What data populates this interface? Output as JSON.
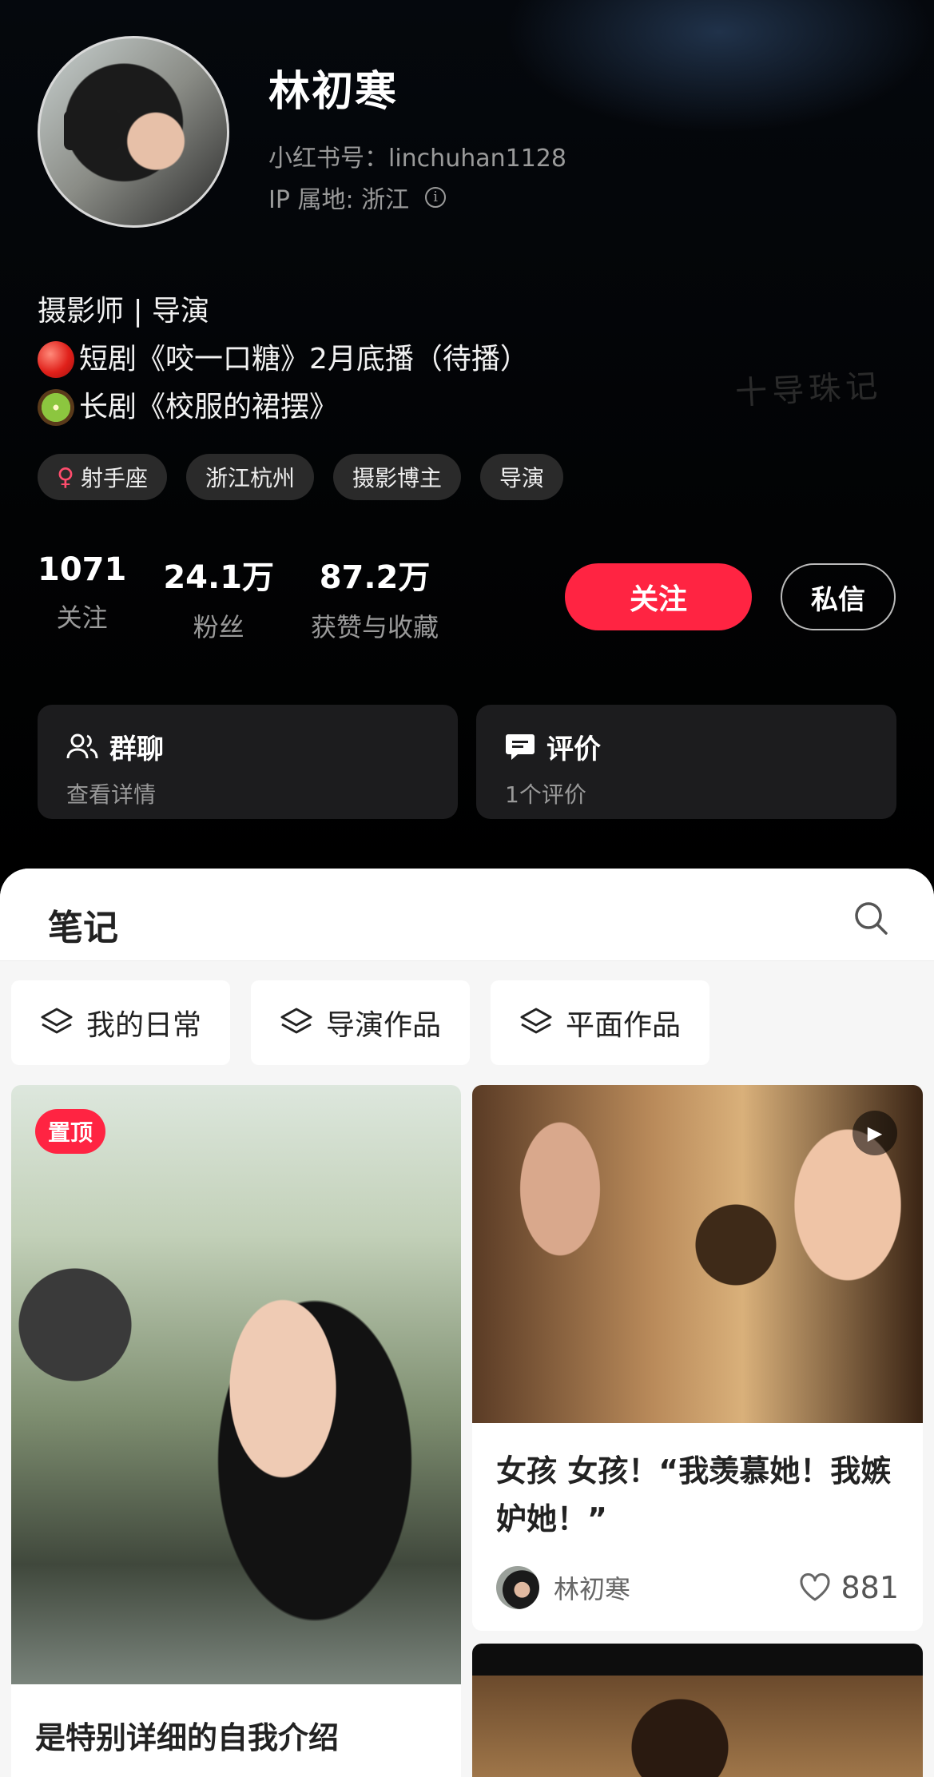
{
  "profile": {
    "name": "林初寒",
    "id_line": "小红书号：linchuhan1128",
    "ip_line": "IP 属地: 浙江",
    "bio_line1": "摄影师 | 导演",
    "bio_line2": "短剧《咬一口糖》2月底播（待播）",
    "bio_line3": "长剧《校服的裙摆》",
    "watermark": "十导珠记",
    "tags": [
      "射手座",
      "浙江杭州",
      "摄影博主",
      "导演"
    ],
    "stats": [
      {
        "num": "1071",
        "label": "关注"
      },
      {
        "num": "24.1万",
        "label": "粉丝"
      },
      {
        "num": "87.2万",
        "label": "获赞与收藏"
      }
    ],
    "follow_label": "关注",
    "message_label": "私信"
  },
  "cards": {
    "group": {
      "title": "群聊",
      "subtitle": "查看详情"
    },
    "review": {
      "title": "评价",
      "subtitle": "1个评价"
    }
  },
  "notes": {
    "title": "笔记",
    "categories": [
      "我的日常",
      "导演作品",
      "平面作品"
    ],
    "posts": [
      {
        "badge": "置顶",
        "caption": "是特别详细的自我介绍"
      },
      {
        "caption": "女孩 女孩！“我羡慕她！我嫉妒她！”",
        "author": "林初寒",
        "likes": "881"
      }
    ]
  },
  "colors": {
    "accent": "#ff2442",
    "background": "#000000",
    "card": "#1c1c1e"
  }
}
